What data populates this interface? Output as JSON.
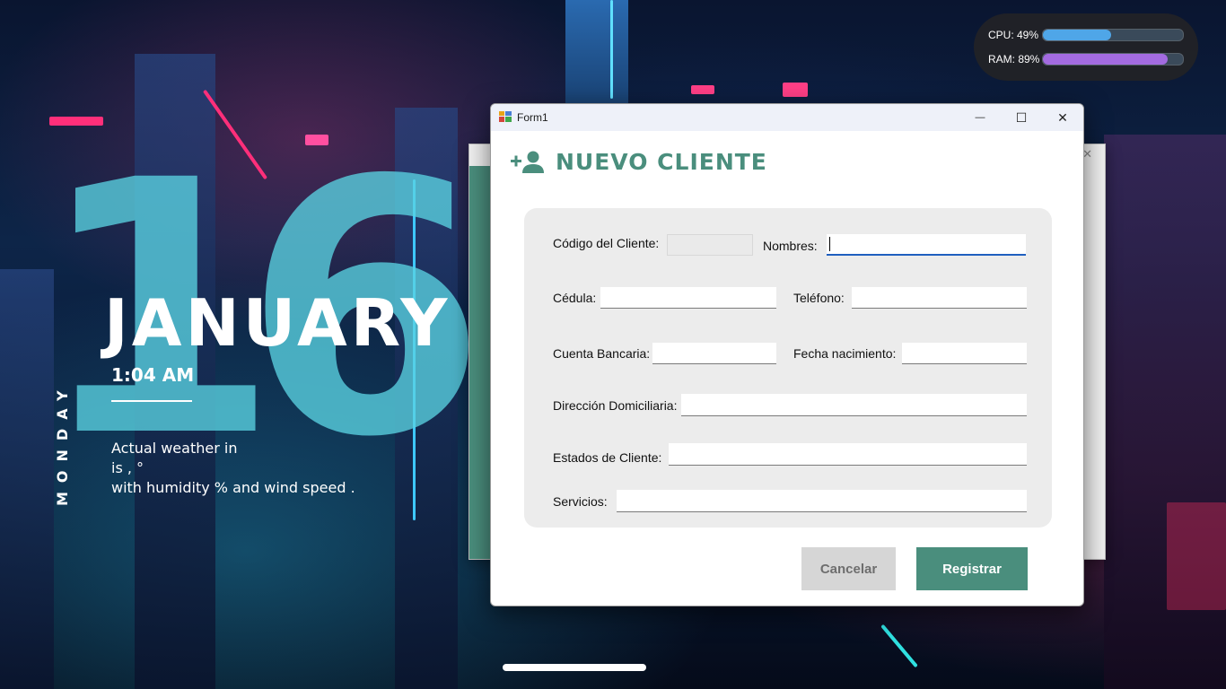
{
  "desktop": {
    "day_number": "16",
    "month": "JANUARY",
    "weekday": "MONDAY",
    "time": "1:04 AM",
    "weather_line1": "Actual weather in",
    "weather_line2": "is , °",
    "weather_line3": "with humidity  % and wind speed  ."
  },
  "perf": {
    "cpu_label": "CPU: 49%",
    "cpu_percent": 49,
    "cpu_color": "#4fa6e8",
    "ram_label": "RAM: 89%",
    "ram_percent": 89,
    "ram_color": "#a36be0"
  },
  "window": {
    "title": "Form1",
    "icon": "winforms-app-icon",
    "minimize_glyph": "—",
    "maximize_glyph": "☐",
    "close_glyph": "✕"
  },
  "form": {
    "header_icon": "add-user-icon",
    "header_title": "NUEVO CLIENTE",
    "accent_color": "#4a8e7d",
    "fields": {
      "codigo_label": "Código del Cliente:",
      "nombres_label": "Nombres:",
      "cedula_label": "Cédula:",
      "telefono_label": "Teléfono:",
      "cuenta_label": "Cuenta Bancaria:",
      "fecha_label": "Fecha nacimiento:",
      "direccion_label": "Dirección Domiciliaria:",
      "estados_label": "Estados de Cliente:",
      "servicios_label": "Servicios:"
    },
    "values": {
      "codigo": "",
      "nombres": "",
      "cedula": "",
      "telefono": "",
      "cuenta": "",
      "fecha": "",
      "direccion": "",
      "estados": "",
      "servicios": ""
    },
    "cancel_label": "Cancelar",
    "submit_label": "Registrar"
  }
}
